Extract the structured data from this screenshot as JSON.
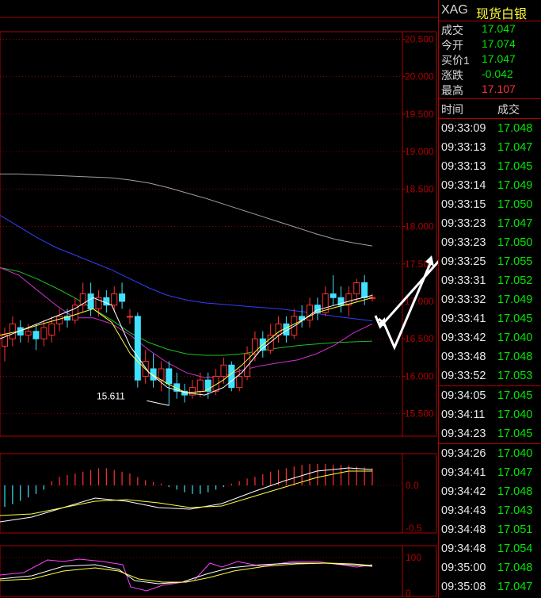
{
  "symbol": "XAG",
  "symbol_name": "现货白银",
  "quote": [
    {
      "label": "成交",
      "value": "17.047",
      "color": "green"
    },
    {
      "label": "今开",
      "value": "17.074",
      "color": "green"
    },
    {
      "label": "买价1",
      "value": "17.047",
      "color": "green"
    },
    {
      "label": "涨跌",
      "value": "-0.042",
      "color": "green"
    },
    {
      "label": "最高",
      "value": "17.107",
      "color": "red"
    }
  ],
  "ticks_header": {
    "time": "时间",
    "price": "成交"
  },
  "ticks": [
    {
      "time": "09:33:09",
      "price": "17.048"
    },
    {
      "time": "09:33:13",
      "price": "17.047"
    },
    {
      "time": "09:33:13",
      "price": "17.045"
    },
    {
      "time": "09:33:14",
      "price": "17.049"
    },
    {
      "time": "09:33:15",
      "price": "17.050"
    },
    {
      "time": "09:33:23",
      "price": "17.047"
    },
    {
      "time": "09:33:23",
      "price": "17.050"
    },
    {
      "time": "09:33:25",
      "price": "17.055"
    },
    {
      "time": "09:33:31",
      "price": "17.052"
    },
    {
      "time": "09:33:32",
      "price": "17.049"
    },
    {
      "time": "09:33:41",
      "price": "17.045"
    },
    {
      "time": "09:33:42",
      "price": "17.040"
    },
    {
      "time": "09:33:48",
      "price": "17.048"
    },
    {
      "time": "09:33:52",
      "price": "17.053"
    },
    {
      "time": "09:34:05",
      "price": "17.045"
    },
    {
      "time": "09:34:11",
      "price": "17.040"
    },
    {
      "time": "09:34:23",
      "price": "17.045"
    },
    {
      "time": "09:34:26",
      "price": "17.040"
    },
    {
      "time": "09:34:41",
      "price": "17.047"
    },
    {
      "time": "09:34:42",
      "price": "17.048"
    },
    {
      "time": "09:34:43",
      "price": "17.043"
    },
    {
      "time": "09:34:48",
      "price": "17.051"
    },
    {
      "time": "09:34:48",
      "price": "17.054"
    },
    {
      "time": "09:35:00",
      "price": "17.048"
    },
    {
      "time": "09:35:08",
      "price": "17.047"
    }
  ],
  "chart_data": {
    "type": "candlestick",
    "y_axis_labels": [
      "20.500",
      "20.000",
      "19.500",
      "19.000",
      "18.500",
      "18.000",
      "17.500",
      "17.000",
      "16.500",
      "16.000",
      "15.500"
    ],
    "ylim": [
      15.2,
      20.6
    ],
    "low_annotation": "15.611",
    "candles": [
      {
        "o": 16.4,
        "c": 16.55,
        "h": 16.65,
        "l": 16.2
      },
      {
        "o": 16.5,
        "c": 16.7,
        "h": 16.8,
        "l": 16.4
      },
      {
        "o": 16.65,
        "c": 16.55,
        "h": 16.75,
        "l": 16.45
      },
      {
        "o": 16.55,
        "c": 16.6,
        "h": 16.7,
        "l": 16.45
      },
      {
        "o": 16.6,
        "c": 16.5,
        "h": 16.7,
        "l": 16.35
      },
      {
        "o": 16.5,
        "c": 16.65,
        "h": 16.75,
        "l": 16.4
      },
      {
        "o": 16.55,
        "c": 16.7,
        "h": 16.8,
        "l": 16.45
      },
      {
        "o": 16.7,
        "c": 16.8,
        "h": 16.9,
        "l": 16.6
      },
      {
        "o": 16.8,
        "c": 16.75,
        "h": 16.9,
        "l": 16.65
      },
      {
        "o": 16.75,
        "c": 16.95,
        "h": 17.05,
        "l": 16.7
      },
      {
        "o": 16.95,
        "c": 17.1,
        "h": 17.25,
        "l": 16.85
      },
      {
        "o": 17.1,
        "c": 16.9,
        "h": 17.25,
        "l": 16.8
      },
      {
        "o": 16.9,
        "c": 17.05,
        "h": 17.15,
        "l": 16.8
      },
      {
        "o": 17.05,
        "c": 16.95,
        "h": 17.15,
        "l": 16.85
      },
      {
        "o": 16.95,
        "c": 17.1,
        "h": 17.2,
        "l": 16.85
      },
      {
        "o": 17.1,
        "c": 17.0,
        "h": 17.25,
        "l": 16.9
      },
      {
        "o": 16.8,
        "c": 16.8,
        "h": 16.9,
        "l": 16.7
      },
      {
        "o": 16.8,
        "c": 15.95,
        "h": 16.85,
        "l": 15.85
      },
      {
        "o": 16.0,
        "c": 16.2,
        "h": 16.35,
        "l": 15.9
      },
      {
        "o": 16.1,
        "c": 15.95,
        "h": 16.3,
        "l": 15.85
      },
      {
        "o": 15.95,
        "c": 16.1,
        "h": 16.2,
        "l": 15.8
      },
      {
        "o": 16.1,
        "c": 15.9,
        "h": 16.2,
        "l": 15.61
      },
      {
        "o": 15.9,
        "c": 15.8,
        "h": 16.05,
        "l": 15.7
      },
      {
        "o": 15.8,
        "c": 15.75,
        "h": 15.9,
        "l": 15.65
      },
      {
        "o": 15.75,
        "c": 15.85,
        "h": 15.95,
        "l": 15.7
      },
      {
        "o": 15.8,
        "c": 15.95,
        "h": 16.05,
        "l": 15.72
      },
      {
        "o": 15.95,
        "c": 15.8,
        "h": 16.05,
        "l": 15.7
      },
      {
        "o": 15.8,
        "c": 16.0,
        "h": 16.1,
        "l": 15.75
      },
      {
        "o": 16.0,
        "c": 16.15,
        "h": 16.25,
        "l": 15.9
      },
      {
        "o": 16.15,
        "c": 15.85,
        "h": 16.2,
        "l": 15.8
      },
      {
        "o": 15.85,
        "c": 16.0,
        "h": 16.1,
        "l": 15.8
      },
      {
        "o": 16.0,
        "c": 16.3,
        "h": 16.4,
        "l": 15.95
      },
      {
        "o": 16.3,
        "c": 16.5,
        "h": 16.6,
        "l": 16.2
      },
      {
        "o": 16.5,
        "c": 16.35,
        "h": 16.6,
        "l": 16.25
      },
      {
        "o": 16.35,
        "c": 16.55,
        "h": 16.7,
        "l": 16.3
      },
      {
        "o": 16.55,
        "c": 16.7,
        "h": 16.8,
        "l": 16.45
      },
      {
        "o": 16.7,
        "c": 16.55,
        "h": 16.8,
        "l": 16.45
      },
      {
        "o": 16.55,
        "c": 16.8,
        "h": 16.9,
        "l": 16.5
      },
      {
        "o": 16.8,
        "c": 16.75,
        "h": 16.95,
        "l": 16.65
      },
      {
        "o": 16.75,
        "c": 16.95,
        "h": 17.05,
        "l": 16.65
      },
      {
        "o": 16.95,
        "c": 16.85,
        "h": 17.05,
        "l": 16.75
      },
      {
        "o": 16.85,
        "c": 17.1,
        "h": 17.2,
        "l": 16.8
      },
      {
        "o": 17.1,
        "c": 17.05,
        "h": 17.35,
        "l": 16.95
      },
      {
        "o": 17.05,
        "c": 16.95,
        "h": 17.2,
        "l": 16.85
      },
      {
        "o": 16.95,
        "c": 17.1,
        "h": 17.2,
        "l": 16.8
      },
      {
        "o": 17.1,
        "c": 17.25,
        "h": 17.3,
        "l": 17.0
      },
      {
        "o": 17.25,
        "c": 17.05,
        "h": 17.35,
        "l": 16.95
      },
      {
        "o": 17.05,
        "c": 17.05,
        "h": 17.1,
        "l": 17.0
      }
    ],
    "ma_white_gray": [
      18.7,
      18.7,
      18.69,
      18.68,
      18.67,
      18.66,
      18.65,
      18.62,
      18.58,
      18.52,
      18.45,
      18.38,
      18.3,
      18.22,
      18.14,
      18.06,
      17.98,
      17.9,
      17.83,
      17.78,
      17.74
    ],
    "ma_blue": [
      18.15,
      18.0,
      17.85,
      17.72,
      17.62,
      17.52,
      17.42,
      17.3,
      17.18,
      17.08,
      17.02,
      16.98,
      16.96,
      16.94,
      16.92,
      16.9,
      16.87,
      16.84,
      16.8,
      16.77,
      16.74
    ],
    "ma_green": [
      17.45,
      17.4,
      17.3,
      17.18,
      17.05,
      16.9,
      16.75,
      16.58,
      16.45,
      16.36,
      16.3,
      16.28,
      16.28,
      16.3,
      16.34,
      16.38,
      16.41,
      16.43,
      16.45,
      16.46,
      16.47
    ],
    "ma_magenta": [
      17.45,
      17.35,
      17.15,
      16.95,
      16.78,
      16.78,
      16.7,
      16.55,
      16.35,
      16.18,
      16.05,
      15.98,
      16.0,
      16.08,
      16.14,
      16.18,
      16.22,
      16.3,
      16.42,
      16.58,
      16.7
    ],
    "ma_yellow": [
      16.55,
      16.6,
      16.68,
      16.75,
      16.82,
      16.9,
      16.72,
      16.3,
      16.05,
      15.9,
      15.78,
      15.8,
      15.95,
      16.15,
      16.4,
      16.6,
      16.72,
      16.85,
      16.92,
      16.98,
      17.05
    ],
    "ma_white": [
      16.5,
      16.6,
      16.7,
      16.8,
      16.9,
      17.05,
      16.95,
      16.4,
      16.05,
      15.85,
      15.78,
      15.75,
      15.85,
      16.05,
      16.35,
      16.55,
      16.7,
      16.88,
      16.95,
      17.02,
      17.08
    ],
    "macd_labels": [
      "0.0",
      "-0.5"
    ],
    "macd_hist": [
      -0.25,
      -0.22,
      -0.18,
      -0.14,
      -0.1,
      -0.05,
      0.05,
      0.1,
      0.12,
      0.14,
      0.16,
      0.18,
      0.2,
      0.2,
      0.18,
      0.16,
      0.14,
      0.1,
      0.06,
      0.04,
      0.02,
      -0.02,
      -0.05,
      -0.08,
      -0.1,
      -0.1,
      -0.08,
      -0.05,
      -0.02,
      0.02,
      0.05,
      0.08,
      0.1,
      0.13,
      0.16,
      0.18,
      0.2,
      0.22,
      0.24,
      0.25,
      0.25,
      0.25,
      0.24,
      0.24,
      0.23,
      0.22,
      0.21,
      0.2
    ],
    "kdj_labels": [
      "100",
      "0"
    ]
  }
}
